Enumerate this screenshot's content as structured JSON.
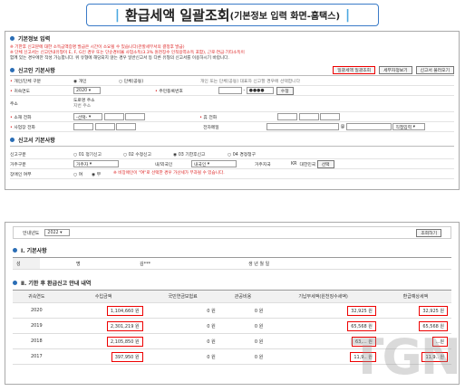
{
  "banner": {
    "bar_left": "|",
    "title": "환급세액 일괄조회",
    "subtitle": "(기본정보 입력 화면-홈택스)",
    "bar_right": "|"
  },
  "panel1": {
    "section_title": "기본정보 입력",
    "notes": [
      "※ 기한후 신고분에 대한 소득금액증명 발급은 시간이 소요될 수 있습니다(관할세무서의 결정후 발급)",
      "※ 단체 신고서는 신고안내유형이 E, F, G인 경우 또는 단순경비율 사업소득(3.3% 원천징수 인적용역소득 포함), 근로·연금·기타소득이",
      "   함께 있는 경우에만 작성 가능합니다. 위 유형에 해당되지 않는 경우 일반신고서 등 다른 유형의 신고서를 이용하시기 바랍니다."
    ],
    "person_label": "신고인 기본사항",
    "buttons": {
      "inquiry": "일괄세액 일괄조회",
      "taxpayer": "세무자정보기",
      "get_form": "신고서 불러오기"
    },
    "rows": [
      {
        "label": "개인/단체 구분",
        "opt1": "개인",
        "opt2": "단체(공동)",
        "hint": "개인 또는 단체(공동) 대표자 신고할 경우에 선택합니다"
      },
      {
        "label": "귀속연도",
        "year": "2020",
        "label2": "주민등록번호",
        "id_mask": "●●●●",
        "id_btn": "수정"
      },
      {
        "label": "주소",
        "addr_line1": "도로명 주소",
        "addr_line2": "지번 주소"
      },
      {
        "label": "소재 전화",
        "select": "-선택-",
        "label2": "휴 전화"
      },
      {
        "label": "사업장 전화",
        "label2": "전자메일",
        "at": "@",
        "mail_select": "직접입력"
      }
    ],
    "sub_title": "신고서 기본사항",
    "sub_rows": [
      {
        "label": "신고구분",
        "opts": [
          "01 정기신고",
          "02 수정신고",
          "03 기한후신고",
          "04 경정청구"
        ]
      },
      {
        "label": "거주구분",
        "value": "거주자",
        "label2": "내/외국인",
        "value2": "내국인",
        "label3": "거주지국",
        "value3": "KR",
        "label4": "대한민국",
        "btn": "선택"
      },
      {
        "label": "장애인 여부",
        "opt1": "여",
        "opt2": "부",
        "note": "※ 비장애인이 \"여\"로 선택한 경우 가산세가 부과될 수 있습니다."
      }
    ]
  },
  "panel2": {
    "year_label": "안내년도",
    "year_value": "2022",
    "search_btn": "조회하기",
    "sec1": "Ⅰ. 기본사항",
    "basic_headers": [
      "성",
      "명",
      "생 년 월 일"
    ],
    "basic_name": "김***",
    "sec2": "Ⅱ. 기한 후 환급신고 안내 내역",
    "columns": [
      "귀속연도",
      "수입금액",
      "국민연금보험료",
      "관공비용",
      "기납부세액(원천징수세액)",
      "환급예상세액"
    ],
    "rows": [
      {
        "year": "2020",
        "income": "1,104,660 원",
        "pension": "0 원",
        "cost": "0 원",
        "paid": "32,925 원",
        "refund": "32,925 원"
      },
      {
        "year": "2019",
        "income": "2,301,219 원",
        "pension": "0 원",
        "cost": "0 원",
        "paid": "65,568 원",
        "refund": "65,568 원"
      },
      {
        "year": "2018",
        "income": "2,105,850 원",
        "pension": "0 원",
        "cost": "0 원",
        "paid": "63,... 원",
        "refund": "...원"
      },
      {
        "year": "2017",
        "income": "397,950 원",
        "pension": "0 원",
        "cost": "0 원",
        "paid": "11,9.. 원",
        "refund": "11,9.. 원"
      }
    ]
  },
  "watermark": "TGN"
}
